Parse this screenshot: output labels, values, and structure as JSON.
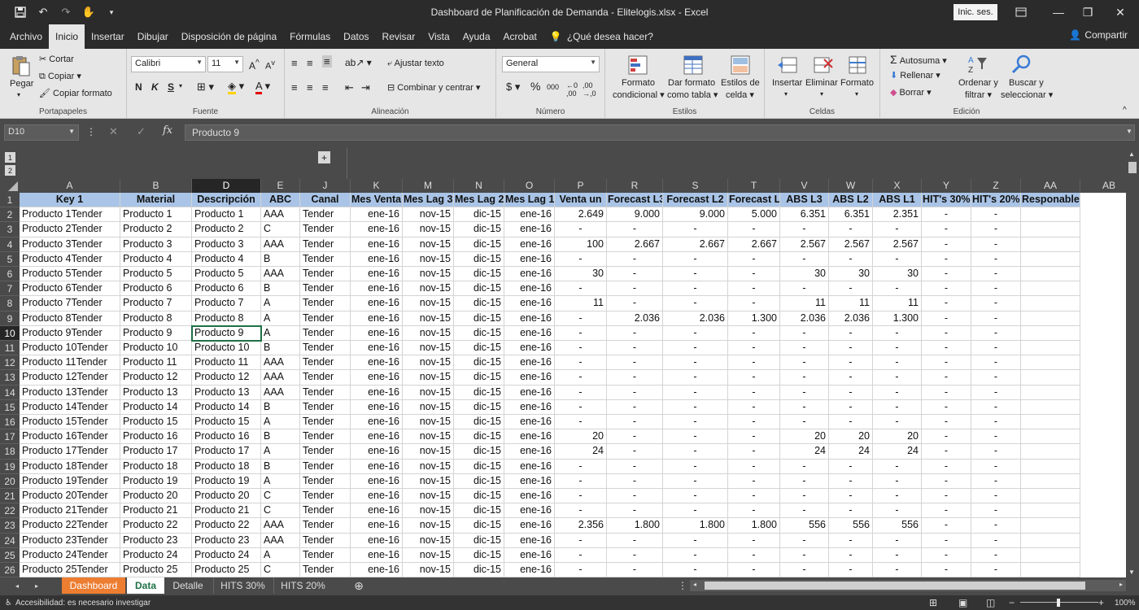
{
  "window": {
    "title": "Dashboard de Planificación de Demanda - Elitelogis.xlsx  -  Excel",
    "signin": "Inic. ses.",
    "share": "Compartir"
  },
  "tabs": [
    "Archivo",
    "Inicio",
    "Insertar",
    "Dibujar",
    "Disposición de página",
    "Fórmulas",
    "Datos",
    "Revisar",
    "Vista",
    "Ayuda",
    "Acrobat"
  ],
  "tell_me": "¿Qué desea hacer?",
  "ribbon": {
    "paste": "Pegar",
    "cut": "Cortar",
    "copy": "Copiar",
    "format_painter": "Copiar formato",
    "clipboard_label": "Portapapeles",
    "font_name": "Calibri",
    "font_size": "11",
    "font_label": "Fuente",
    "wrap_text": "Ajustar texto",
    "merge_center": "Combinar y centrar",
    "alignment_label": "Alineación",
    "number_format": "General",
    "number_label": "Número",
    "cond_format_1": "Formato",
    "cond_format_2": "condicional",
    "table_format_1": "Dar formato",
    "table_format_2": "como tabla",
    "cell_styles_1": "Estilos de",
    "cell_styles_2": "celda",
    "styles_label": "Estilos",
    "insert": "Insertar",
    "delete": "Eliminar",
    "format": "Formato",
    "cells_label": "Celdas",
    "autosum": "Autosuma",
    "fill": "Rellenar",
    "clear": "Borrar",
    "sort_1": "Ordenar y",
    "sort_2": "filtrar",
    "find_1": "Buscar y",
    "find_2": "seleccionar",
    "editing_label": "Edición",
    "bold": "N",
    "italic": "K",
    "underline": "S"
  },
  "formula_bar": {
    "name_box": "D10",
    "content": "Producto 9"
  },
  "column_letters": [
    "A",
    "B",
    "D",
    "E",
    "J",
    "K",
    "M",
    "N",
    "O",
    "P",
    "R",
    "S",
    "T",
    "V",
    "W",
    "X",
    "Y",
    "Z",
    "AA",
    "AB"
  ],
  "headers": [
    "Key 1",
    "Material",
    "Descripción",
    "ABC",
    "Canal",
    "Mes Venta",
    "Mes Lag 3",
    "Mes Lag 2",
    "Mes Lag 1",
    "Venta un",
    "Forecast L3",
    "Forecast L2",
    "Forecast L1",
    "ABS L3",
    "ABS L2",
    "ABS L1",
    "HIT's 30%",
    "HIT's 20%",
    "Responable"
  ],
  "rows": [
    [
      "Producto 1Tender",
      "Producto 1",
      "Producto 1",
      "AAA",
      "Tender",
      "ene-16",
      "nov-15",
      "dic-15",
      "ene-16",
      "2.649",
      "9.000",
      "9.000",
      "5.000",
      "6.351",
      "6.351",
      "2.351",
      "-",
      "-",
      ""
    ],
    [
      "Producto 2Tender",
      "Producto 2",
      "Producto 2",
      "C",
      "Tender",
      "ene-16",
      "nov-15",
      "dic-15",
      "ene-16",
      "-",
      "-",
      "-",
      "-",
      "-",
      "-",
      "-",
      "-",
      "-",
      ""
    ],
    [
      "Producto 3Tender",
      "Producto 3",
      "Producto 3",
      "AAA",
      "Tender",
      "ene-16",
      "nov-15",
      "dic-15",
      "ene-16",
      "100",
      "2.667",
      "2.667",
      "2.667",
      "2.567",
      "2.567",
      "2.567",
      "-",
      "-",
      ""
    ],
    [
      "Producto 4Tender",
      "Producto 4",
      "Producto 4",
      "B",
      "Tender",
      "ene-16",
      "nov-15",
      "dic-15",
      "ene-16",
      "-",
      "-",
      "-",
      "-",
      "-",
      "-",
      "-",
      "-",
      "-",
      ""
    ],
    [
      "Producto 5Tender",
      "Producto 5",
      "Producto 5",
      "AAA",
      "Tender",
      "ene-16",
      "nov-15",
      "dic-15",
      "ene-16",
      "30",
      "-",
      "-",
      "-",
      "30",
      "30",
      "30",
      "-",
      "-",
      ""
    ],
    [
      "Producto 6Tender",
      "Producto 6",
      "Producto 6",
      "B",
      "Tender",
      "ene-16",
      "nov-15",
      "dic-15",
      "ene-16",
      "-",
      "-",
      "-",
      "-",
      "-",
      "-",
      "-",
      "-",
      "-",
      ""
    ],
    [
      "Producto 7Tender",
      "Producto 7",
      "Producto 7",
      "A",
      "Tender",
      "ene-16",
      "nov-15",
      "dic-15",
      "ene-16",
      "11",
      "-",
      "-",
      "-",
      "11",
      "11",
      "11",
      "-",
      "-",
      ""
    ],
    [
      "Producto 8Tender",
      "Producto 8",
      "Producto 8",
      "A",
      "Tender",
      "ene-16",
      "nov-15",
      "dic-15",
      "ene-16",
      "-",
      "2.036",
      "2.036",
      "1.300",
      "2.036",
      "2.036",
      "1.300",
      "-",
      "-",
      ""
    ],
    [
      "Producto 9Tender",
      "Producto 9",
      "Producto 9",
      "A",
      "Tender",
      "ene-16",
      "nov-15",
      "dic-15",
      "ene-16",
      "-",
      "-",
      "-",
      "-",
      "-",
      "-",
      "-",
      "-",
      "-",
      ""
    ],
    [
      "Producto 10Tender",
      "Producto 10",
      "Producto 10",
      "B",
      "Tender",
      "ene-16",
      "nov-15",
      "dic-15",
      "ene-16",
      "-",
      "-",
      "-",
      "-",
      "-",
      "-",
      "-",
      "-",
      "-",
      ""
    ],
    [
      "Producto 11Tender",
      "Producto 11",
      "Producto 11",
      "AAA",
      "Tender",
      "ene-16",
      "nov-15",
      "dic-15",
      "ene-16",
      "-",
      "-",
      "-",
      "-",
      "-",
      "-",
      "-",
      "-",
      "-",
      ""
    ],
    [
      "Producto 12Tender",
      "Producto 12",
      "Producto 12",
      "AAA",
      "Tender",
      "ene-16",
      "nov-15",
      "dic-15",
      "ene-16",
      "-",
      "-",
      "-",
      "-",
      "-",
      "-",
      "-",
      "-",
      "-",
      ""
    ],
    [
      "Producto 13Tender",
      "Producto 13",
      "Producto 13",
      "AAA",
      "Tender",
      "ene-16",
      "nov-15",
      "dic-15",
      "ene-16",
      "-",
      "-",
      "-",
      "-",
      "-",
      "-",
      "-",
      "-",
      "-",
      ""
    ],
    [
      "Producto 14Tender",
      "Producto 14",
      "Producto 14",
      "B",
      "Tender",
      "ene-16",
      "nov-15",
      "dic-15",
      "ene-16",
      "-",
      "-",
      "-",
      "-",
      "-",
      "-",
      "-",
      "-",
      "-",
      ""
    ],
    [
      "Producto 15Tender",
      "Producto 15",
      "Producto 15",
      "A",
      "Tender",
      "ene-16",
      "nov-15",
      "dic-15",
      "ene-16",
      "-",
      "-",
      "-",
      "-",
      "-",
      "-",
      "-",
      "-",
      "-",
      ""
    ],
    [
      "Producto 16Tender",
      "Producto 16",
      "Producto 16",
      "B",
      "Tender",
      "ene-16",
      "nov-15",
      "dic-15",
      "ene-16",
      "20",
      "-",
      "-",
      "-",
      "20",
      "20",
      "20",
      "-",
      "-",
      ""
    ],
    [
      "Producto 17Tender",
      "Producto 17",
      "Producto 17",
      "A",
      "Tender",
      "ene-16",
      "nov-15",
      "dic-15",
      "ene-16",
      "24",
      "-",
      "-",
      "-",
      "24",
      "24",
      "24",
      "-",
      "-",
      ""
    ],
    [
      "Producto 18Tender",
      "Producto 18",
      "Producto 18",
      "B",
      "Tender",
      "ene-16",
      "nov-15",
      "dic-15",
      "ene-16",
      "-",
      "-",
      "-",
      "-",
      "-",
      "-",
      "-",
      "-",
      "-",
      ""
    ],
    [
      "Producto 19Tender",
      "Producto 19",
      "Producto 19",
      "A",
      "Tender",
      "ene-16",
      "nov-15",
      "dic-15",
      "ene-16",
      "-",
      "-",
      "-",
      "-",
      "-",
      "-",
      "-",
      "-",
      "-",
      ""
    ],
    [
      "Producto 20Tender",
      "Producto 20",
      "Producto 20",
      "C",
      "Tender",
      "ene-16",
      "nov-15",
      "dic-15",
      "ene-16",
      "-",
      "-",
      "-",
      "-",
      "-",
      "-",
      "-",
      "-",
      "-",
      ""
    ],
    [
      "Producto 21Tender",
      "Producto 21",
      "Producto 21",
      "C",
      "Tender",
      "ene-16",
      "nov-15",
      "dic-15",
      "ene-16",
      "-",
      "-",
      "-",
      "-",
      "-",
      "-",
      "-",
      "-",
      "-",
      ""
    ],
    [
      "Producto 22Tender",
      "Producto 22",
      "Producto 22",
      "AAA",
      "Tender",
      "ene-16",
      "nov-15",
      "dic-15",
      "ene-16",
      "2.356",
      "1.800",
      "1.800",
      "1.800",
      "556",
      "556",
      "556",
      "-",
      "-",
      ""
    ],
    [
      "Producto 23Tender",
      "Producto 23",
      "Producto 23",
      "AAA",
      "Tender",
      "ene-16",
      "nov-15",
      "dic-15",
      "ene-16",
      "-",
      "-",
      "-",
      "-",
      "-",
      "-",
      "-",
      "-",
      "-",
      ""
    ],
    [
      "Producto 24Tender",
      "Producto 24",
      "Producto 24",
      "A",
      "Tender",
      "ene-16",
      "nov-15",
      "dic-15",
      "ene-16",
      "-",
      "-",
      "-",
      "-",
      "-",
      "-",
      "-",
      "-",
      "-",
      ""
    ],
    [
      "Producto 25Tender",
      "Producto 25",
      "Producto 25",
      "C",
      "Tender",
      "ene-16",
      "nov-15",
      "dic-15",
      "ene-16",
      "-",
      "-",
      "-",
      "-",
      "-",
      "-",
      "-",
      "-",
      "-",
      ""
    ]
  ],
  "sheet_tabs": [
    "Dashboard",
    "Data",
    "Detalle",
    "HITS 30%",
    "HITS 20%"
  ],
  "status": {
    "accessibility": "Accesibilidad: es necesario investigar",
    "zoom": "100%"
  },
  "outline_levels": [
    "1",
    "2"
  ],
  "colors": {
    "header_fill": "#a9c4e6",
    "dashboard_tab": "#ed7d31",
    "selection": "#1e7145"
  }
}
